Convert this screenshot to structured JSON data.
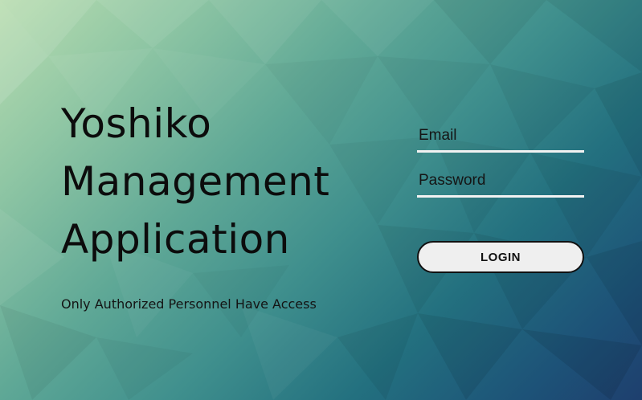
{
  "header": {
    "title_lines": [
      "Yoshiko",
      "Management",
      "Application"
    ],
    "subtitle": "Only Authorized Personnel Have Access"
  },
  "login": {
    "email_placeholder": "Email",
    "password_placeholder": "Password",
    "button_label": "LOGIN"
  },
  "colors": {
    "gradient_light": "#b9ddb0",
    "gradient_mid": "#3f8f8d",
    "gradient_dark": "#1e3f6e",
    "field_underline": "#f2f2f2",
    "button_fill": "#efefef",
    "text": "#0c0c0c"
  }
}
